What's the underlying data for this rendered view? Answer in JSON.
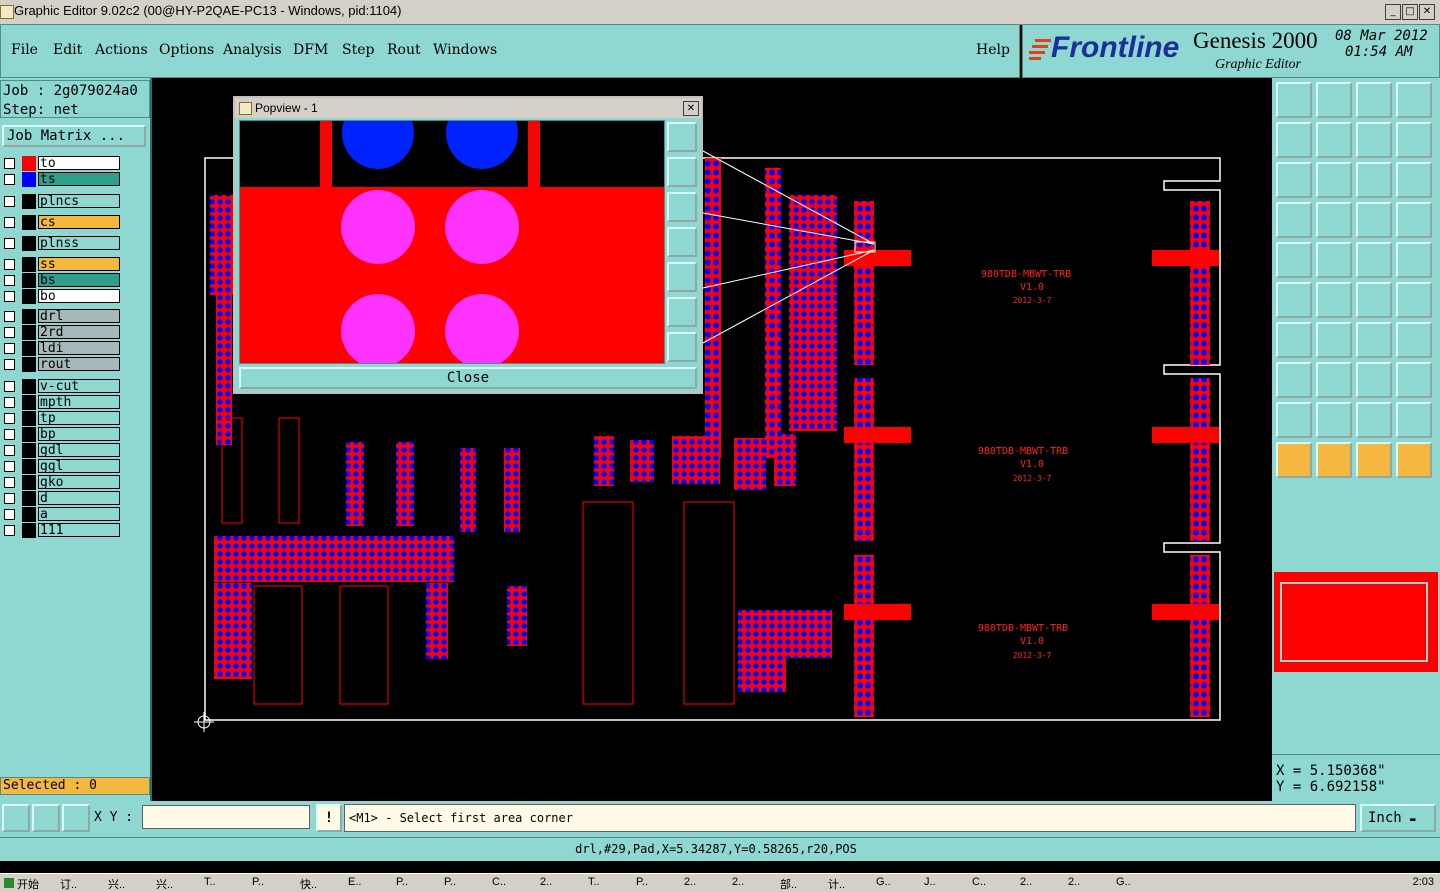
{
  "window": {
    "title": "Graphic Editor 9.02c2 (00@HY-P2QAE-PC13 - Windows, pid:1104)",
    "minimize_glyph": "_",
    "maximize_glyph": "□",
    "close_glyph": "✕"
  },
  "menu": {
    "file": "File",
    "edit": "Edit",
    "actions": "Actions",
    "options": "Options",
    "analysis": "Analysis",
    "dfm": "DFM",
    "step": "Step",
    "rout": "Rout",
    "windows": "Windows",
    "help": "Help"
  },
  "header": {
    "brand": "Frontline",
    "product": "Genesis 2000",
    "subtitle": "Graphic Editor",
    "date": "08 Mar 2012",
    "time": "01:54 AM"
  },
  "job": {
    "job_line": "Job : 2g079024a0",
    "step_line": "Step: net",
    "matrix_button": "Job Matrix ..."
  },
  "layers": [
    {
      "name": "to",
      "color": "#ffffff",
      "swatch": "#ff0000"
    },
    {
      "name": "ts",
      "color": "#2e9f8a",
      "swatch": "#0000ff"
    },
    {
      "name": "plncs",
      "color": "#8fd8d2",
      "swatch": "#000000"
    },
    {
      "name": "cs",
      "color": "#f4b840",
      "swatch": "#000000"
    },
    {
      "name": "plnss",
      "color": "#8fd8d2",
      "swatch": "#000000"
    },
    {
      "name": "ss",
      "color": "#f4b840",
      "swatch": "#000000"
    },
    {
      "name": "bs",
      "color": "#2e9f8a",
      "swatch": "#000000"
    },
    {
      "name": "bo",
      "color": "#ffffff",
      "swatch": "#000000"
    },
    {
      "name": "drl",
      "color": "#a7b8bb",
      "swatch": "#000000"
    },
    {
      "name": "2rd",
      "color": "#a7b8bb",
      "swatch": "#000000"
    },
    {
      "name": "ldi",
      "color": "#a7b8bb",
      "swatch": "#000000"
    },
    {
      "name": "rout",
      "color": "#a7b8bb",
      "swatch": "#000000"
    },
    {
      "name": "v-cut",
      "color": "#8fd8d2",
      "swatch": "#000000"
    },
    {
      "name": "mpth",
      "color": "#8fd8d2",
      "swatch": "#000000"
    },
    {
      "name": "tp",
      "color": "#8fd8d2",
      "swatch": "#000000"
    },
    {
      "name": "bp",
      "color": "#8fd8d2",
      "swatch": "#000000"
    },
    {
      "name": "gdl",
      "color": "#8fd8d2",
      "swatch": "#000000"
    },
    {
      "name": "ggl",
      "color": "#8fd8d2",
      "swatch": "#000000"
    },
    {
      "name": "gko",
      "color": "#8fd8d2",
      "swatch": "#000000"
    },
    {
      "name": "d",
      "color": "#8fd8d2",
      "swatch": "#000000"
    },
    {
      "name": "a",
      "color": "#8fd8d2",
      "swatch": "#000000"
    },
    {
      "name": "111",
      "color": "#8fd8d2",
      "swatch": "#000000"
    }
  ],
  "selected": "Selected : 0",
  "popview": {
    "title": "Popview - 1",
    "close_label": "Close"
  },
  "board": {
    "labels": [
      {
        "name": "980TDB-MBWT-TRB",
        "ver": "V1.0",
        "date": "2012-3-7"
      },
      {
        "name": "980TDB-MBWT-TRB",
        "ver": "V1.0",
        "date": "2012-3-7"
      },
      {
        "name": "980TDB-MBWT-TRB",
        "ver": "V1.0",
        "date": "2012-3-7"
      }
    ]
  },
  "coords": {
    "x": "X = 5.150368\"",
    "y": "Y = 6.692158\""
  },
  "bottom": {
    "xy_label": "X Y :",
    "xy_value": "",
    "prompt": "<M1> - Select first area corner",
    "units": "Inch",
    "status": "drl,#29,Pad,X=5.34287,Y=0.58265,r20,POS"
  },
  "taskbar": {
    "start": "开始",
    "time": "2:03",
    "items": [
      "订..",
      "兴..",
      "兴..",
      "T..",
      "P..",
      "快..",
      "E..",
      "P..",
      "P..",
      "C..",
      "2..",
      "T..",
      "P..",
      "2..",
      "2..",
      "部..",
      "计..",
      "G..",
      "J..",
      "C..",
      "2..",
      "2..",
      "G.."
    ]
  },
  "colors": {
    "panel": "#8fd8d2",
    "accent_orange": "#f4b840",
    "pcb_red": "#ff0000",
    "pcb_blue": "#0000ff",
    "pcb_magenta": "#ff33ff"
  }
}
